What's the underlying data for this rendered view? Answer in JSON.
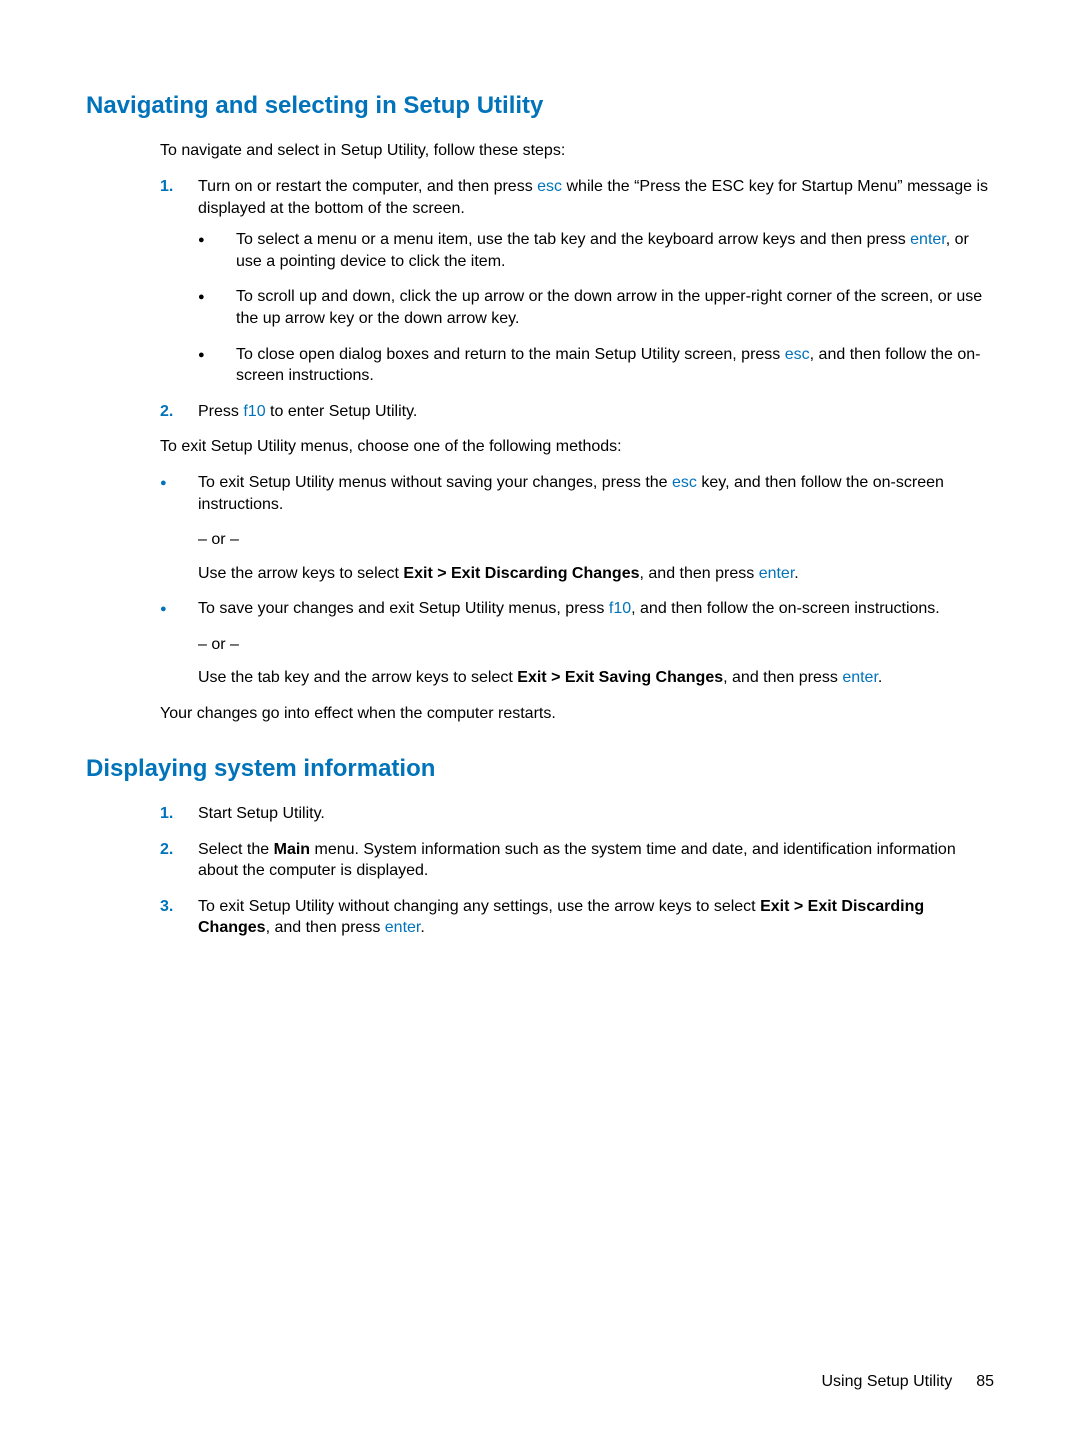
{
  "section1": {
    "heading": "Navigating and selecting in Setup Utility",
    "intro": "To navigate and select in Setup Utility, follow these steps:",
    "step1_num": "1.",
    "step1_a": "Turn on or restart the computer, and then press ",
    "step1_esc": "esc",
    "step1_b": " while the “Press the ESC key for Startup Menu” message is displayed at the bottom of the screen.",
    "bullet1_a": "To select a menu or a menu item, use the tab key and the keyboard arrow keys and then press ",
    "bullet1_enter": "enter",
    "bullet1_b": ", or use a pointing device to click the item.",
    "bullet2": "To scroll up and down, click the up arrow or the down arrow in the upper-right corner of the screen, or use the up arrow key or the down arrow key.",
    "bullet3_a": "To close open dialog boxes and return to the main Setup Utility screen, press ",
    "bullet3_esc": "esc",
    "bullet3_b": ", and then follow the on-screen instructions.",
    "step2_num": "2.",
    "step2_a": "Press ",
    "step2_f10": "f10",
    "step2_b": " to enter Setup Utility.",
    "exit_intro": "To exit Setup Utility menus, choose one of the following methods:",
    "exitA_a": "To exit Setup Utility menus without saving your changes, press the ",
    "exitA_esc": "esc",
    "exitA_b": " key, and then follow the on-screen instructions.",
    "or": "– or –",
    "exitA_alt_a": "Use the arrow keys to select ",
    "exitA_alt_bold": "Exit > Exit Discarding Changes",
    "exitA_alt_b": ", and then press ",
    "exitA_alt_enter": "enter",
    "exitA_alt_c": ".",
    "exitB_a": "To save your changes and exit Setup Utility menus, press ",
    "exitB_f10": "f10",
    "exitB_b": ", and then follow the on-screen instructions.",
    "exitB_alt_a": "Use the tab key and the arrow keys to select ",
    "exitB_alt_bold": "Exit > Exit Saving Changes",
    "exitB_alt_b": ", and then press ",
    "exitB_alt_enter": "enter",
    "exitB_alt_c": ".",
    "closing": "Your changes go into effect when the computer restarts."
  },
  "section2": {
    "heading": "Displaying system information",
    "step1_num": "1.",
    "step1": "Start Setup Utility.",
    "step2_num": "2.",
    "step2_a": "Select the ",
    "step2_bold": "Main",
    "step2_b": " menu. System information such as the system time and date, and identification information about the computer is displayed.",
    "step3_num": "3.",
    "step3_a": "To exit Setup Utility without changing any settings, use the arrow keys to select ",
    "step3_bold": "Exit > Exit Discarding Changes",
    "step3_b": ", and then press ",
    "step3_enter": "enter",
    "step3_c": "."
  },
  "footer": {
    "label": "Using Setup Utility",
    "page": "85"
  }
}
